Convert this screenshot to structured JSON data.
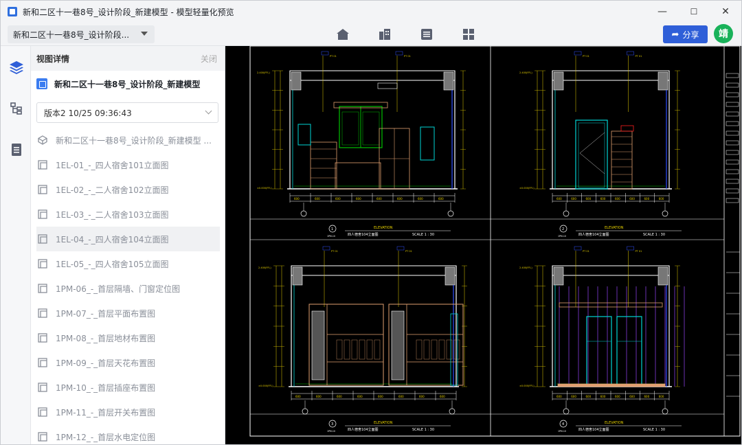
{
  "window": {
    "title": "新和二区十一巷8号_设计阶段_新建模型 - 模型轻量化预览",
    "minimize": "—",
    "maximize": "☐",
    "close": "✕"
  },
  "toolbar": {
    "model_select": "新和二区十一巷8号_设计阶段...",
    "tools": [
      "home-icon",
      "building-icon",
      "list-icon",
      "grid-icon"
    ],
    "share_label": "分享",
    "avatar_text": "靖"
  },
  "rail": {
    "icons": [
      "layers-icon",
      "tree-icon",
      "document-icon"
    ]
  },
  "panel": {
    "title": "视图详情",
    "close_label": "关闭",
    "model_title": "新和二区十一巷8号_设计阶段_新建模型",
    "version": "版本2 10/25 09:36:43",
    "items": [
      {
        "label": "新和二区十一巷8号_设计阶段_新建模型 ...",
        "icon": "3d-view-icon"
      },
      {
        "label": "1EL-01_-_四人宿舍101立面图",
        "icon": "sheet-icon"
      },
      {
        "label": "1EL-02_-_二人宿舍102立面图",
        "icon": "sheet-icon"
      },
      {
        "label": "1EL-03_-_二人宿舍103立面图",
        "icon": "sheet-icon"
      },
      {
        "label": "1EL-04_-_四人宿舍104立面图",
        "icon": "sheet-icon",
        "selected": true
      },
      {
        "label": "1EL-05_-_四人宿舍105立面图",
        "icon": "sheet-icon"
      },
      {
        "label": "1PM-06_-_首层隔墙、门窗定位图",
        "icon": "sheet-icon"
      },
      {
        "label": "1PM-07_-_首层平面布置图",
        "icon": "sheet-icon"
      },
      {
        "label": "1PM-08_-_首层地材布置图",
        "icon": "sheet-icon"
      },
      {
        "label": "1PM-09_-_首层天花布置图",
        "icon": "sheet-icon"
      },
      {
        "label": "1PM-10_-_首层插座布置图",
        "icon": "sheet-icon"
      },
      {
        "label": "1PM-11_-_首层开关布置图",
        "icon": "sheet-icon"
      },
      {
        "label": "1PM-12_-_首层水电定位图",
        "icon": "sheet-icon"
      }
    ]
  },
  "drawing": {
    "views": [
      {
        "number": "1",
        "heading": "ELEVATION",
        "name": "四人宿舍104立面图",
        "scale": "SCALE 1 : 30",
        "sheet": "1PM-10"
      },
      {
        "number": "2",
        "heading": "ELEVATION",
        "name": "四人宿舍104立面图",
        "scale": "SCALE 1 : 30",
        "sheet": "1PM-10"
      },
      {
        "number": "3",
        "heading": "ELEVATION",
        "name": "四人宿舍104立面图",
        "scale": "SCALE 1 : 30",
        "sheet": "1PM-10"
      },
      {
        "number": "4",
        "heading": "ELEVATION",
        "name": "四人宿舍104立面图",
        "scale": "SCALE 1 : 30",
        "sheet": "1PM-10"
      }
    ]
  },
  "colors": {
    "accent": "#2f5fd8",
    "avatar": "#19b25a",
    "cad_background": "#000000",
    "cad_yellow": "#e8d200",
    "cad_white": "#ffffff",
    "cad_cyan": "#00d6d6",
    "cad_green": "#00c000",
    "cad_red": "#ff2020",
    "cad_orange": "#e0a070",
    "cad_purple": "#6a2fb0"
  }
}
